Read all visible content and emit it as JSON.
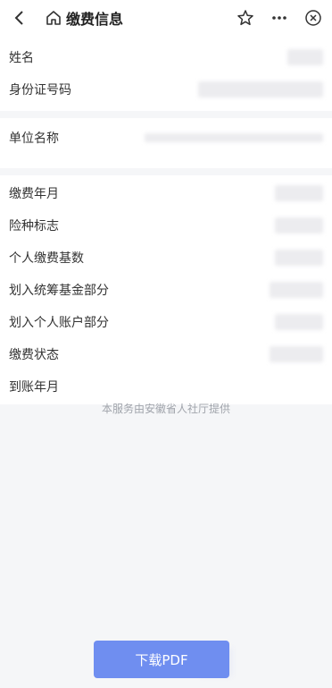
{
  "header": {
    "title": "缴费信息"
  },
  "personal": {
    "name_label": "姓名",
    "id_label": "身份证号码"
  },
  "employer": {
    "unit_label": "单位名称"
  },
  "payment": {
    "items": [
      {
        "label": "缴费年月"
      },
      {
        "label": "险种标志"
      },
      {
        "label": "个人缴费基数"
      },
      {
        "label": "划入统筹基金部分"
      },
      {
        "label": "划入个人账户部分"
      },
      {
        "label": "缴费状态"
      },
      {
        "label": "到账年月"
      }
    ]
  },
  "footer": {
    "provider_note": "本服务由安徽省人社厅提供"
  },
  "actions": {
    "download_label": "下载PDF"
  },
  "colors": {
    "accent": "#6f8ef0",
    "background": "#f5f6f8"
  }
}
